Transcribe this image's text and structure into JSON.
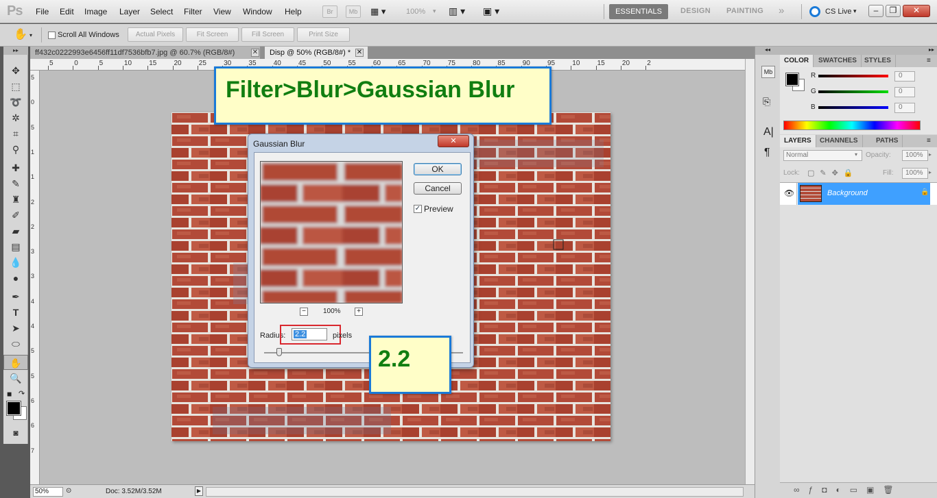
{
  "app": {
    "logo": "Ps"
  },
  "menu": [
    "File",
    "Edit",
    "Image",
    "Layer",
    "Select",
    "Filter",
    "View",
    "Window",
    "Help"
  ],
  "menubar_icons": {
    "bridge": "Br",
    "minibridge": "Mb",
    "zoom_level": "100%"
  },
  "workspaces": {
    "essentials": "ESSENTIALS",
    "design": "DESIGN",
    "painting": "PAINTING",
    "more": "»"
  },
  "cs_live": "CS Live",
  "options": {
    "scroll_all": "Scroll All Windows",
    "actual_pixels": "Actual Pixels",
    "fit_screen": "Fit Screen",
    "fill_screen": "Fill Screen",
    "print_size": "Print Size"
  },
  "tabs": [
    {
      "label": "ff432c0222993e6456ff11df7536bfb7.jpg @ 60.7% (RGB/8#)"
    },
    {
      "label": "Disp @ 50% (RGB/8#) *"
    }
  ],
  "ruler_ticks": [
    "5",
    "0",
    "5",
    "10",
    "15",
    "20",
    "25",
    "30",
    "35",
    "40",
    "45",
    "50",
    "55",
    "60",
    "65",
    "70",
    "75",
    "80",
    "85",
    "90",
    "95",
    "10",
    "15",
    "20",
    "2"
  ],
  "vruler_ticks": [
    "5",
    "0",
    "5",
    "1",
    "1",
    "2",
    "2",
    "3",
    "3",
    "4",
    "4",
    "5",
    "5",
    "6",
    "6",
    "7"
  ],
  "status": {
    "zoom": "50%",
    "doc": "Doc: 3.52M/3.52M"
  },
  "color_panel": {
    "tabs": [
      "COLOR",
      "SWATCHES",
      "STYLES"
    ],
    "channels": [
      {
        "label": "R",
        "value": "0",
        "color": "#d22"
      },
      {
        "label": "G",
        "value": "0",
        "color": "#2b2"
      },
      {
        "label": "B",
        "value": "0",
        "color": "#22c"
      }
    ]
  },
  "layers_panel": {
    "tabs": [
      "LAYERS",
      "CHANNELS",
      "PATHS"
    ],
    "blend_mode": "Normal",
    "opacity_label": "Opacity:",
    "opacity": "100%",
    "lock_label": "Lock:",
    "fill_label": "Fill:",
    "fill": "100%",
    "layers": [
      {
        "name": "Background"
      }
    ]
  },
  "dialog": {
    "title": "Gaussian Blur",
    "ok": "OK",
    "cancel": "Cancel",
    "preview": "Preview",
    "zoom": "100%",
    "zoom_out": "−",
    "zoom_in": "+",
    "radius_label": "Radius:",
    "radius_value": "2.2",
    "unit": "pixels"
  },
  "callouts": {
    "menu_path": "Filter>Blur>Gaussian Blur",
    "value": "2.2"
  },
  "colors": {
    "accent_blue": "#1a7ad8",
    "callout_text": "#117e11",
    "callout_bg": "#fffec8",
    "layer_selected": "#3fa0ff",
    "highlight_red": "#d9272e"
  }
}
